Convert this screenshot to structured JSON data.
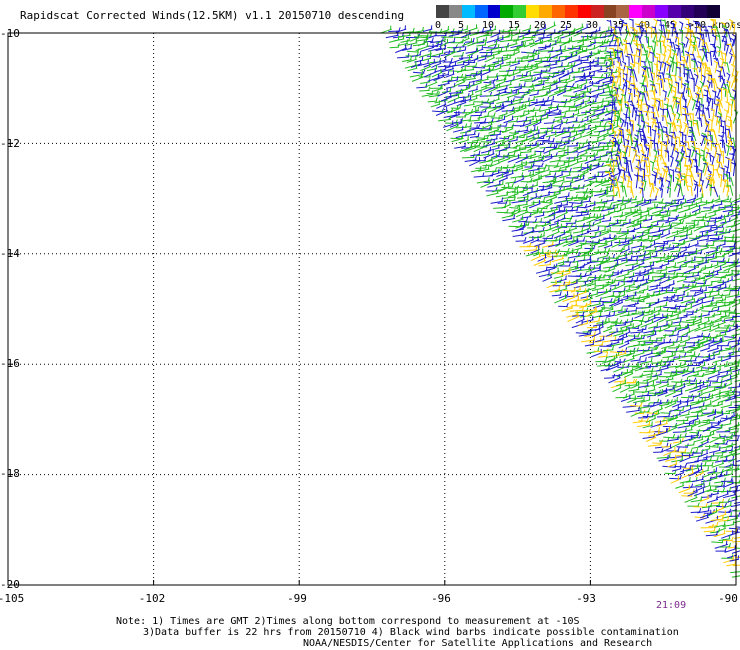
{
  "title": "Rapidscat Corrected Winds(12.5KM) v1.1 20150710 descending",
  "colorbar": {
    "colors": [
      "#444444",
      "#888888",
      "#00bbff",
      "#0066ff",
      "#0000cc",
      "#00aa00",
      "#33cc33",
      "#ffdd00",
      "#ffaa00",
      "#ff6600",
      "#ff3300",
      "#ff0000",
      "#cc2222",
      "#884422",
      "#aa6644",
      "#ff00ff",
      "#cc00cc",
      "#8800ff",
      "#5500aa",
      "#330077",
      "#220055",
      "#110033"
    ],
    "labels": [
      "0",
      "5",
      "10",
      "15",
      "20",
      "25",
      "30",
      "35",
      "40",
      "45",
      ">50 knots"
    ]
  },
  "axes": {
    "y_labels": [
      "-10",
      "-12",
      "-14",
      "-16",
      "-18",
      "-20"
    ],
    "x_labels": [
      "-105",
      "-102",
      "-99",
      "-96",
      "-93",
      "-90"
    ]
  },
  "time_label": "21:09",
  "notes": [
    "Note: 1) Times are GMT 2)Times along bottom correspond to measurement at -10S",
    "3)Data buffer is 22 hrs from 20150710 4) Black wind barbs indicate possible contamination",
    "NOAA/NESDIS/Center for Satellite Applications and Research"
  ],
  "map": {
    "lon_range": [
      -105,
      -90
    ],
    "lat_range": [
      -20,
      -10
    ],
    "wind_colors": {
      "green": "#22bb22",
      "blue": "#1a1acc",
      "yellow": "#ffcc00"
    }
  }
}
